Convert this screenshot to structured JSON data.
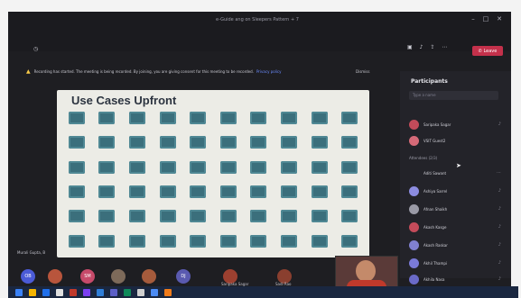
{
  "window": {
    "title": "e-Guide ang on Sleepers Pattern + 7",
    "controls": [
      "–",
      "□",
      "✕"
    ]
  },
  "toolbar": {
    "leave_label": "Leave",
    "icons": [
      "camera-icon",
      "mic-icon",
      "share-icon",
      "more-icon"
    ]
  },
  "recording_banner": {
    "text": "Recording has started. The meeting is being recorded. By joining, you are giving consent for this meeting to be recorded.",
    "policy_link": "Privacy policy",
    "dismiss_label": "Dismiss"
  },
  "slide": {
    "title": "Use Cases Upfront",
    "tile_color": "#3b6f7c",
    "cells": [
      "",
      "",
      "",
      "",
      "",
      "",
      "",
      "",
      "",
      "",
      "",
      "",
      "",
      "",
      "",
      "",
      "",
      "",
      "",
      "",
      "",
      "",
      "",
      "",
      "",
      "",
      "",
      "",
      "",
      "",
      "",
      "",
      "",
      "",
      "",
      "",
      "",
      "",
      "",
      "",
      "",
      "",
      "",
      "",
      "",
      "",
      "",
      "",
      "",
      "",
      "",
      "",
      "",
      "",
      "",
      "",
      "",
      "",
      "",
      ""
    ]
  },
  "presenter_label": "Murali Gupta, B",
  "participants_panel": {
    "title": "Participants",
    "search_placeholder": "Type a name",
    "presenters": [
      {
        "name": "Saripaka Sagar"
      },
      {
        "name": "VSIT Guest2"
      }
    ],
    "attendees_label": "Attendees (2/3)",
    "attendees": [
      {
        "name": "Aditi Sawant"
      },
      {
        "name": "Ashiya Sarrel"
      },
      {
        "name": "Afnan Shaikh"
      },
      {
        "name": "Akash Kasge"
      },
      {
        "name": "Akash Raskar"
      },
      {
        "name": "Akhil Thampi"
      },
      {
        "name": "Akhila Nasa"
      }
    ]
  },
  "bottom_videos": [
    {
      "initials": "OB",
      "color": "#4b5bd6"
    },
    {
      "initials": "",
      "color": "#b8553c"
    },
    {
      "initials": "SM",
      "color": "#c64a6a"
    },
    {
      "initials": "",
      "color": "#7d6a5a"
    },
    {
      "initials": "",
      "color": "#a55b3c"
    },
    {
      "initials": "DJ",
      "color": "#5a5ab0"
    },
    {
      "initials": "",
      "color": "#9c4030"
    },
    {
      "initials": "",
      "color": "#8a3f2f"
    }
  ],
  "video_labels": [
    "Saripaka Sagar",
    "Sadi Rao"
  ],
  "taskbar_colors": [
    "#3a82f7",
    "#f4b400",
    "#1f6feb",
    "#e0e0e0",
    "#c0392b",
    "#7b3ff2",
    "#2f7ed8",
    "#5b5fc7",
    "#0e8a5a",
    "#d0d0d0",
    "#4b8bf4",
    "#f07b1a"
  ]
}
